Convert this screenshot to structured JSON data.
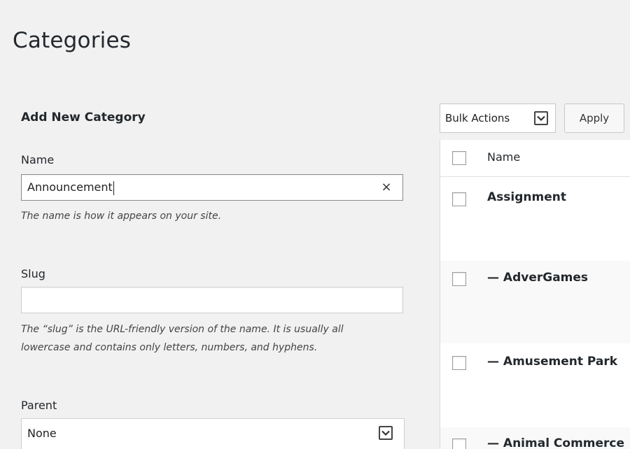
{
  "page": {
    "title": "Categories"
  },
  "form": {
    "heading": "Add New Category",
    "name": {
      "label": "Name",
      "value": "Announcement",
      "clear_symbol": "×",
      "hint": "The name is how it appears on your site."
    },
    "slug": {
      "label": "Slug",
      "value": "",
      "hint_line1": "The “slug” is the URL-friendly version of the name. It is usually all",
      "hint_line2": "lowercase and contains only letters, numbers, and hyphens."
    },
    "parent": {
      "label": "Parent",
      "selected": "None"
    }
  },
  "table": {
    "bulk_actions": {
      "selected": "Bulk Actions"
    },
    "apply_label": "Apply",
    "columns": [
      "Name"
    ],
    "rows": [
      {
        "name": "Assignment"
      },
      {
        "name": "— AdverGames"
      },
      {
        "name": "— Amusement Park"
      },
      {
        "name": "— Animal Commerce"
      }
    ]
  },
  "icons": {
    "dropdown": "chevron-down-icon",
    "clear": "close-icon"
  }
}
